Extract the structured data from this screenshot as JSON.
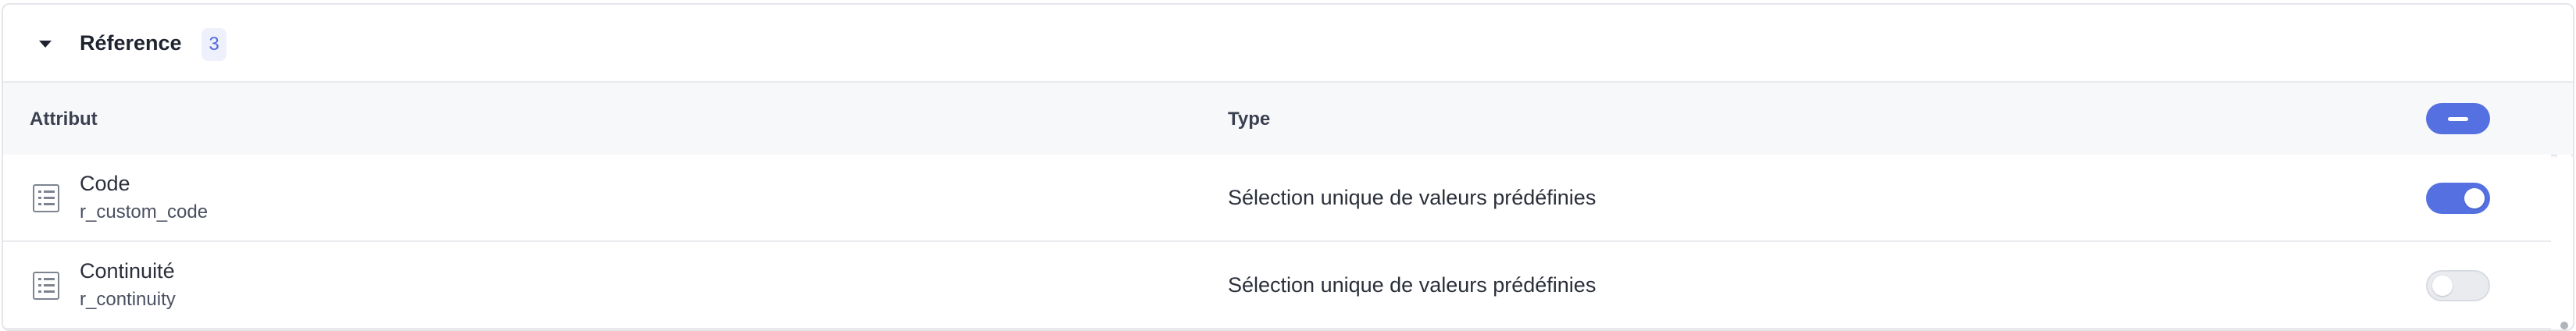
{
  "section": {
    "title": "Réference",
    "count": "3"
  },
  "table": {
    "headers": {
      "attribute": "Attribut",
      "type": "Type"
    },
    "rows": [
      {
        "name": "Code",
        "code": "r_custom_code",
        "type": "Sélection unique de valeurs prédéfinies",
        "enabled": true
      },
      {
        "name": "Continuité",
        "code": "r_continuity",
        "type": "Sélection unique de valeurs prédéfinies",
        "enabled": false
      }
    ]
  },
  "icons": {
    "section_toggle": "caret-down-icon",
    "row_attribute": "list-icon",
    "header_toggle": "minus-icon"
  },
  "colors": {
    "accent": "#5570e0",
    "badge_bg": "#eef1fb",
    "header_bg": "#f7f8fa",
    "toggle_off": "#e9ebef"
  }
}
